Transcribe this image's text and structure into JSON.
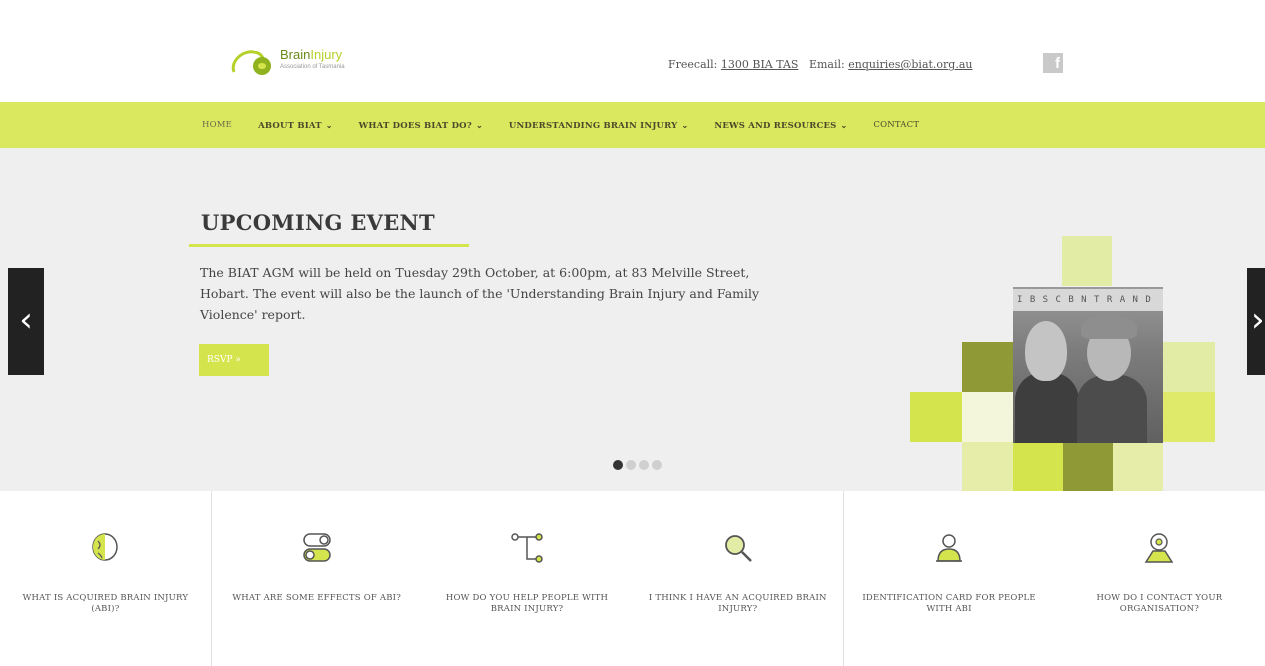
{
  "header": {
    "logo_word_1": "Brain",
    "logo_word_2": "Injury",
    "logo_tagline": "Association of Tasmania",
    "freecall_label": "Freecall:",
    "freecall_number": "1300 BIA TAS",
    "email_label": "Email:",
    "email_address": "enquiries@biat.org.au",
    "facebook_icon": "facebook-icon"
  },
  "nav": {
    "items": [
      {
        "label": "HOME",
        "has_caret": false
      },
      {
        "label": "ABOUT BIAT",
        "has_caret": true
      },
      {
        "label": "WHAT DOES BIAT DO?",
        "has_caret": true
      },
      {
        "label": "UNDERSTANDING BRAIN INJURY",
        "has_caret": true
      },
      {
        "label": "NEWS AND RESOURCES",
        "has_caret": true
      },
      {
        "label": "CONTACT",
        "has_caret": false
      }
    ],
    "caret": "⌄"
  },
  "hero": {
    "title": "UPCOMING EVENT",
    "body": "The BIAT AGM will be held on Tuesday 29th October, at 6:00pm, at 83 Melville Street, Hobart. The event will also be the launch of the 'Understanding Brain Injury and Family Violence' report.",
    "button_label": "RSVP »",
    "prev_arrow": "‹",
    "next_arrow": "›",
    "slides_count": 4,
    "active_slide": 1,
    "photo_banner": "I B S C B N T R A N D",
    "accent_color": "#d4e44c",
    "nav_color": "#d9e85e"
  },
  "features": [
    {
      "icon": "brain-icon",
      "label": "WHAT IS ACQUIRED BRAIN INJURY (ABI)?"
    },
    {
      "icon": "toggle-icon",
      "label": "WHAT ARE SOME EFFECTS OF ABI?"
    },
    {
      "icon": "network-icon",
      "label": "HOW DO YOU HELP PEOPLE WITH BRAIN INJURY?"
    },
    {
      "icon": "magnifier-icon",
      "label": "I THINK I HAVE AN ACQUIRED BRAIN INJURY?"
    },
    {
      "icon": "id-card-person-icon",
      "label": "IDENTIFICATION CARD FOR PEOPLE WITH ABI"
    },
    {
      "icon": "map-pin-icon",
      "label": "HOW DO I CONTACT YOUR ORGANISATION?"
    }
  ]
}
